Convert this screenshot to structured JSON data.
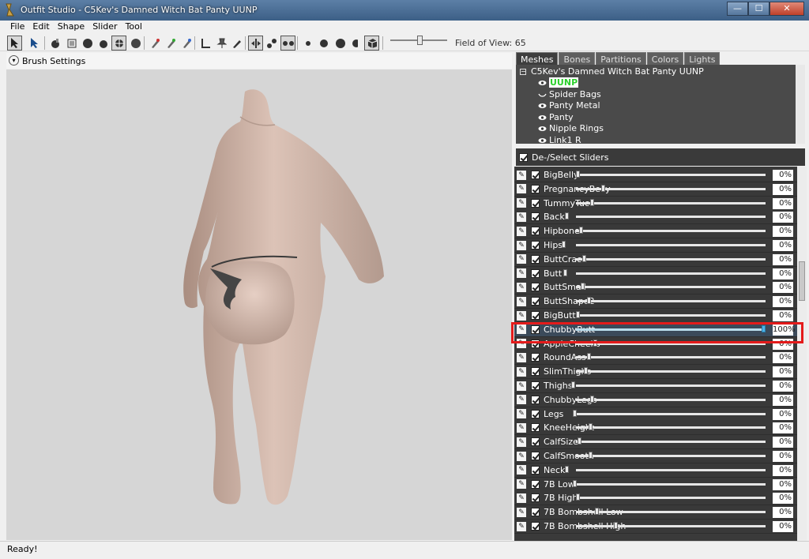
{
  "window": {
    "title": "Outfit Studio - C5Kev's Damned Witch Bat Panty UUNP",
    "buttons": {
      "minimize": "—",
      "maximize": "☐",
      "close": "✕"
    }
  },
  "menu": [
    "File",
    "Edit",
    "Shape",
    "Slider",
    "Tool"
  ],
  "toolbar": {
    "field_of_view_label": "Field of View: 65",
    "field_of_view_value": 65
  },
  "brush_settings": {
    "label": "Brush Settings"
  },
  "right_pane": {
    "tabs": [
      "Meshes",
      "Bones",
      "Partitions",
      "Colors",
      "Lights"
    ],
    "active_tab": "Meshes",
    "tree_root": "C5Kev's Damned Witch Bat Panty UUNP",
    "meshes": [
      "UUNP",
      "Spider Bags",
      "Panty Metal",
      "Panty",
      "Nipple Rings",
      "Link1 R"
    ],
    "selected_mesh": "UUNP",
    "deselect_label": "De-/Select Sliders"
  },
  "sliders": [
    {
      "name": "BigBelly",
      "value": "0%",
      "level": 0
    },
    {
      "name": "PregnancyBelly",
      "value": "0%",
      "level": 0
    },
    {
      "name": "TummyTuck",
      "value": "0%",
      "level": 0
    },
    {
      "name": "Back",
      "value": "0%",
      "level": 0
    },
    {
      "name": "Hipbone",
      "value": "0%",
      "level": 0
    },
    {
      "name": "Hips",
      "value": "0%",
      "level": 0
    },
    {
      "name": "ButtCrack",
      "value": "0%",
      "level": 0
    },
    {
      "name": "Butt",
      "value": "0%",
      "level": 0
    },
    {
      "name": "ButtSmall",
      "value": "0%",
      "level": 0
    },
    {
      "name": "ButtShape2",
      "value": "0%",
      "level": 0
    },
    {
      "name": "BigButt",
      "value": "0%",
      "level": 0
    },
    {
      "name": "ChubbyButt",
      "value": "100%",
      "level": 1
    },
    {
      "name": "AppleCheeks",
      "value": "0%",
      "level": 0
    },
    {
      "name": "RoundAss",
      "value": "0%",
      "level": 0
    },
    {
      "name": "SlimThighs",
      "value": "0%",
      "level": 0
    },
    {
      "name": "Thighs",
      "value": "0%",
      "level": 0
    },
    {
      "name": "ChubbyLegs",
      "value": "0%",
      "level": 0
    },
    {
      "name": "Legs",
      "value": "0%",
      "level": 0
    },
    {
      "name": "KneeHeight",
      "value": "0%",
      "level": 0
    },
    {
      "name": "CalfSize",
      "value": "0%",
      "level": 0
    },
    {
      "name": "CalfSmooth",
      "value": "0%",
      "level": 0
    },
    {
      "name": "Neck",
      "value": "0%",
      "level": 0
    },
    {
      "name": "7B Low",
      "value": "0%",
      "level": 0
    },
    {
      "name": "7B High",
      "value": "0%",
      "level": 0
    },
    {
      "name": "7B Bombshell Low",
      "value": "0%",
      "level": 0
    },
    {
      "name": "7B Bombshell High",
      "value": "0%",
      "level": 0
    }
  ],
  "highlighted_slider": "ChubbyButt",
  "status": {
    "text": "Ready!"
  },
  "colors": {
    "highlight_box": "#e41b1b",
    "selected_mesh_text": "#2cd02c"
  }
}
